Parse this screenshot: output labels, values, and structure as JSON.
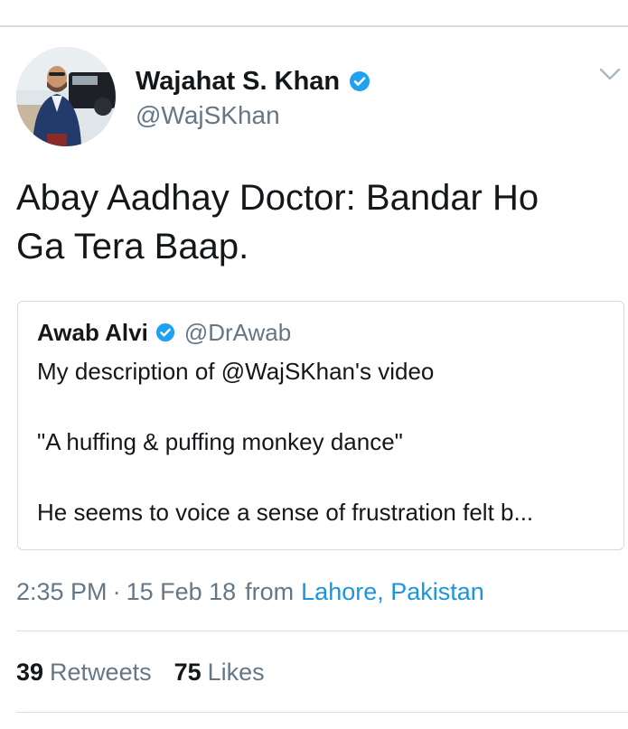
{
  "tweet": {
    "author": {
      "display_name": "Wajahat S. Khan",
      "handle": "@WajSKhan",
      "verified": true
    },
    "text_lines": [
      "Abay Aadhay Doctor: Bandar Ho",
      "Ga Tera Baap."
    ],
    "quoted": {
      "display_name": "Awab Alvi",
      "handle": "@DrAwab",
      "verified": true,
      "lines": [
        "My description of @WajSKhan's video",
        "\"A huffing & puffing monkey dance\"",
        "He seems to voice a sense of frustration felt b..."
      ]
    },
    "meta": {
      "time": "2:35 PM",
      "separator": "·",
      "date": "15 Feb 18",
      "from_label": "from",
      "location": "Lahore, Pakistan"
    },
    "stats": {
      "retweets_count": "39",
      "retweets_label": "Retweets",
      "likes_count": "75",
      "likes_label": "Likes"
    }
  },
  "colors": {
    "text_primary": "#14171a",
    "text_secondary": "#657786",
    "link": "#1b95e0",
    "verified_badge": "#1da1f2",
    "divider": "#d9dde0"
  },
  "icons": {
    "verified": "verified-badge-icon",
    "menu": "chevron-down-icon"
  }
}
